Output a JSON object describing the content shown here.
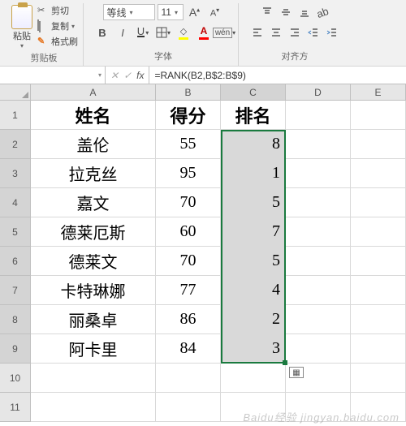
{
  "ribbon": {
    "clipboard": {
      "paste_label": "粘贴",
      "cut_label": "剪切",
      "copy_label": "复制",
      "format_painter_label": "格式刷",
      "group_label": "剪贴板"
    },
    "font": {
      "font_name": "等线",
      "font_size": "11",
      "group_label": "字体",
      "bold": "B",
      "italic": "I",
      "underline": "U",
      "phonetic": "wén",
      "inc_font": "A",
      "dec_font": "A",
      "colors": {
        "fill": "#ffff00",
        "font": "#ff0000"
      }
    },
    "align": {
      "group_label": "对齐方"
    }
  },
  "formula_bar": {
    "name_box": "",
    "fx": "fx",
    "formula": "=RANK(B2,B$2:B$9)"
  },
  "columns": [
    "A",
    "B",
    "C",
    "D",
    "E"
  ],
  "headers": {
    "A": "姓名",
    "B": "得分",
    "C": "排名"
  },
  "chart_data": {
    "type": "table",
    "columns": [
      "姓名",
      "得分",
      "排名"
    ],
    "rows": [
      {
        "name": "盖伦",
        "score": 55,
        "rank": 8
      },
      {
        "name": "拉克丝",
        "score": 95,
        "rank": 1
      },
      {
        "name": "嘉文",
        "score": 70,
        "rank": 5
      },
      {
        "name": "德莱厄斯",
        "score": 60,
        "rank": 7
      },
      {
        "name": "德莱文",
        "score": 70,
        "rank": 5
      },
      {
        "name": "卡特琳娜",
        "score": 77,
        "rank": 4
      },
      {
        "name": "丽桑卓",
        "score": 86,
        "rank": 2
      },
      {
        "name": "阿卡里",
        "score": 84,
        "rank": 3
      }
    ]
  },
  "watermark": "Baidu经验  jingyan.baidu.com"
}
